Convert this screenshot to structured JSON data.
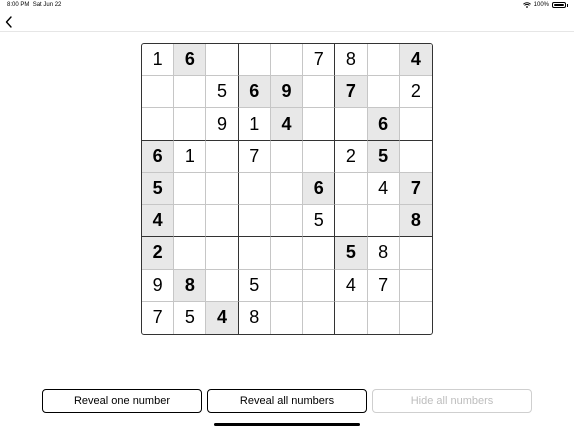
{
  "status_bar": {
    "time": "8:00 PM",
    "date": "Sat Jun 22",
    "battery": "100%"
  },
  "nav": {
    "back_icon": "chevron-left-icon"
  },
  "board": {
    "cells": [
      [
        {
          "v": "1",
          "given": false
        },
        {
          "v": "6",
          "given": true
        },
        {
          "v": "",
          "given": false
        },
        {
          "v": "",
          "given": false
        },
        {
          "v": "",
          "given": false
        },
        {
          "v": "7",
          "given": false
        },
        {
          "v": "8",
          "given": false
        },
        {
          "v": "",
          "given": false
        },
        {
          "v": "4",
          "given": true
        }
      ],
      [
        {
          "v": "",
          "given": false
        },
        {
          "v": "",
          "given": false
        },
        {
          "v": "5",
          "given": false
        },
        {
          "v": "6",
          "given": true
        },
        {
          "v": "9",
          "given": true
        },
        {
          "v": "",
          "given": false
        },
        {
          "v": "7",
          "given": true
        },
        {
          "v": "",
          "given": false
        },
        {
          "v": "2",
          "given": false
        }
      ],
      [
        {
          "v": "",
          "given": false
        },
        {
          "v": "",
          "given": false
        },
        {
          "v": "9",
          "given": false
        },
        {
          "v": "1",
          "given": false
        },
        {
          "v": "4",
          "given": true
        },
        {
          "v": "",
          "given": false
        },
        {
          "v": "",
          "given": false
        },
        {
          "v": "6",
          "given": true
        },
        {
          "v": "",
          "given": false
        }
      ],
      [
        {
          "v": "6",
          "given": true
        },
        {
          "v": "1",
          "given": false
        },
        {
          "v": "",
          "given": false
        },
        {
          "v": "7",
          "given": false
        },
        {
          "v": "",
          "given": false
        },
        {
          "v": "",
          "given": false
        },
        {
          "v": "2",
          "given": false
        },
        {
          "v": "5",
          "given": true
        },
        {
          "v": "",
          "given": false
        }
      ],
      [
        {
          "v": "5",
          "given": true
        },
        {
          "v": "",
          "given": false
        },
        {
          "v": "",
          "given": false
        },
        {
          "v": "",
          "given": false
        },
        {
          "v": "",
          "given": false
        },
        {
          "v": "6",
          "given": true
        },
        {
          "v": "",
          "given": false
        },
        {
          "v": "4",
          "given": false
        },
        {
          "v": "7",
          "given": true
        }
      ],
      [
        {
          "v": "4",
          "given": true
        },
        {
          "v": "",
          "given": false
        },
        {
          "v": "",
          "given": false
        },
        {
          "v": "",
          "given": false
        },
        {
          "v": "",
          "given": false
        },
        {
          "v": "5",
          "given": false
        },
        {
          "v": "",
          "given": false
        },
        {
          "v": "",
          "given": false
        },
        {
          "v": "8",
          "given": true
        }
      ],
      [
        {
          "v": "2",
          "given": true
        },
        {
          "v": "",
          "given": false
        },
        {
          "v": "",
          "given": false
        },
        {
          "v": "",
          "given": false
        },
        {
          "v": "",
          "given": false
        },
        {
          "v": "",
          "given": false
        },
        {
          "v": "5",
          "given": true
        },
        {
          "v": "8",
          "given": false
        },
        {
          "v": "",
          "given": false
        }
      ],
      [
        {
          "v": "9",
          "given": false
        },
        {
          "v": "8",
          "given": true
        },
        {
          "v": "",
          "given": false
        },
        {
          "v": "5",
          "given": false
        },
        {
          "v": "",
          "given": false
        },
        {
          "v": "",
          "given": false
        },
        {
          "v": "4",
          "given": false
        },
        {
          "v": "7",
          "given": false
        },
        {
          "v": "",
          "given": false
        }
      ],
      [
        {
          "v": "7",
          "given": false
        },
        {
          "v": "5",
          "given": false
        },
        {
          "v": "4",
          "given": true
        },
        {
          "v": "8",
          "given": false
        },
        {
          "v": "",
          "given": false
        },
        {
          "v": "",
          "given": false
        },
        {
          "v": "",
          "given": false
        },
        {
          "v": "",
          "given": false
        },
        {
          "v": "",
          "given": false
        }
      ]
    ]
  },
  "buttons": {
    "reveal_one": "Reveal one number",
    "reveal_all": "Reveal all numbers",
    "hide_all": "Hide all numbers",
    "hide_all_disabled": true
  }
}
